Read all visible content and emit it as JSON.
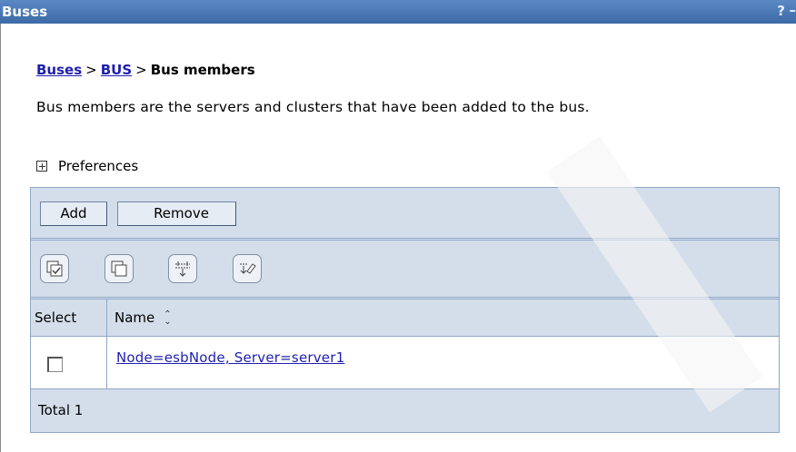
{
  "window": {
    "title": "Buses",
    "help_glyph": "?",
    "minimize_glyph": "–"
  },
  "breadcrumb": {
    "items": [
      "Buses",
      "BUS",
      "Bus members"
    ],
    "separator": ">"
  },
  "description": "Bus members are the servers and clusters that have been added to the bus.",
  "preferences": {
    "label": "Preferences"
  },
  "toolbar": {
    "add_label": "Add",
    "remove_label": "Remove",
    "icons": [
      "select-all-icon",
      "deselect-all-icon",
      "show-filter-icon",
      "clear-filter-icon"
    ]
  },
  "table": {
    "columns": [
      "Select",
      "Name"
    ],
    "rows": [
      {
        "selected": false,
        "name": "Node=esbNode, Server=server1"
      }
    ],
    "total_label": "Total 1"
  },
  "colors": {
    "titlebar": "#4a78b4",
    "panel": "#d4deeb",
    "link": "#1f1fb0",
    "border": "#8fa7c6"
  }
}
